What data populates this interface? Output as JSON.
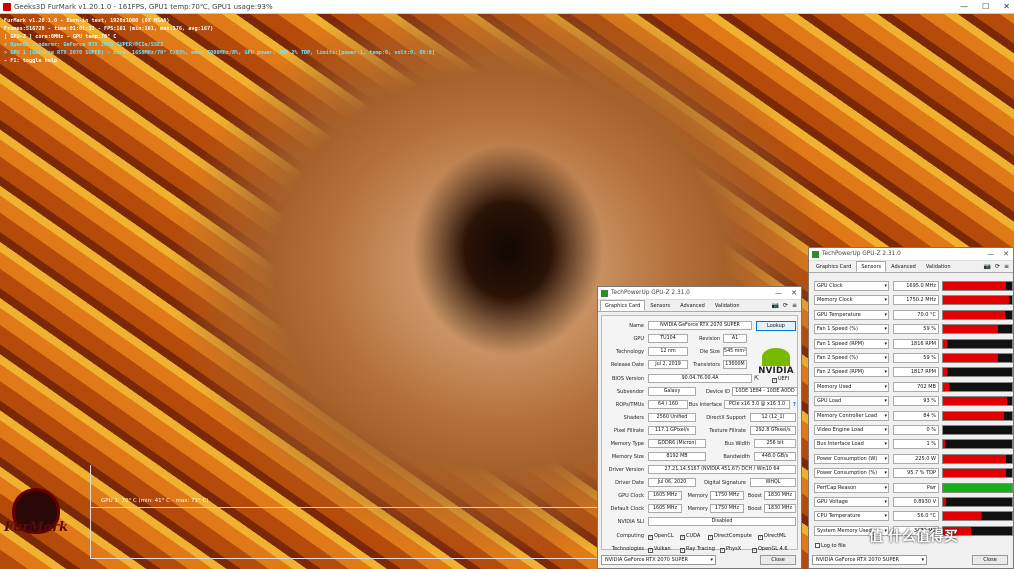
{
  "furmark": {
    "window_title": "Geeks3D FurMark v1.20.1.0 - 161FPS, GPU1 temp:70℃, GPU1 usage:93%",
    "hud": [
      {
        "t": "FurMark v1.20.1.0 - Burn-in test, 1920x1080 (8X MSAA)",
        "c": "w"
      },
      {
        "t": "Frames:516720 - time:01:01:32 - FPS:161 (min:161, max:176, avg:167)",
        "c": "w"
      },
      {
        "t": "[ GPU-Z ] core:0MHz - GPU temp:70° C",
        "c": "w"
      },
      {
        "t": "> OpenGL renderer: GeForce RTX 2070 SUPER/PCIe/SSE2",
        "c": "c"
      },
      {
        "t": "> GPU 1 (GeForce RTX 2070 SUPER) - core: 1650MHz/70° C/93%, mem: 7000MHz/8%, GPU power: 100.2% TDP, limits:[power:1, temp:0, volt:0, OV:0]",
        "c": "c"
      },
      {
        "t": "- F1: toggle help",
        "c": "w"
      }
    ],
    "graph_label": "GPU 1: 70° C (min: 41° C - max: 71° C)",
    "logo": "FurMark"
  },
  "gpuz_card": {
    "title": "TechPowerUp GPU-Z 2.31.0",
    "tabs": [
      "Graphics Card",
      "Sensors",
      "Advanced",
      "Validation"
    ],
    "labels": {
      "name": "Name",
      "gpu": "GPU",
      "revision": "Revision",
      "technology": "Technology",
      "die_size": "Die Size",
      "release_date": "Release Date",
      "transistors": "Transistors",
      "bios": "BIOS Version",
      "subvendor": "Subvendor",
      "device_id": "Device ID",
      "rops": "ROPs/TMUs",
      "bus": "Bus Interface",
      "shaders": "Shaders",
      "directx": "DirectX Support",
      "pixel": "Pixel Fillrate",
      "texture": "Texture Fillrate",
      "mem_type": "Memory Type",
      "bus_width": "Bus Width",
      "mem_size": "Memory Size",
      "bandwidth": "Bandwidth",
      "driver": "Driver Version",
      "driver_date": "Driver Date",
      "digsig": "Digital Signature",
      "gpu_clock": "GPU Clock",
      "memory": "Memory",
      "boost": "Boost",
      "default_clock": "Default Clock",
      "sli": "NVIDIA SLI",
      "computing": "Computing",
      "technologies": "Technologies"
    },
    "values": {
      "name": "NVIDIA GeForce RTX 2070 SUPER",
      "gpu": "TU104",
      "revision": "A1",
      "technology": "12 nm",
      "die_size": "545 mm²",
      "release_date": "Jul 2, 2019",
      "transistors": "13600M",
      "bios": "90.04.76.00.4A",
      "subvendor": "Galaxy",
      "device_id": "10DE 1E84 - 10DE A0DD",
      "rops": "64 / 160",
      "bus": "PCIe x16 3.0 @ x16 3.0",
      "shaders": "2560 Unified",
      "directx": "12 (12_1)",
      "pixel": "117.1 GPixel/s",
      "texture": "292.8 GTexel/s",
      "mem_type": "GDDR6 (Micron)",
      "bus_width": "256 bit",
      "mem_size": "8192 MB",
      "bandwidth": "448.0 GB/s",
      "driver": "27.21.14.5167 (NVIDIA 451.67) DCH / Win10 64",
      "driver_date": "Jul 06, 2020",
      "digsig": "WHQL",
      "gpu_clock": "1605 MHz",
      "gpu_mem": "1750 MHz",
      "gpu_boost": "1830 MHz",
      "def_clock": "1605 MHz",
      "def_mem": "1750 MHz",
      "def_boost": "1830 MHz",
      "sli": "Disabled"
    },
    "lookup": "Lookup",
    "uefi": "UEFI",
    "question": "?",
    "brand": "NVIDIA",
    "computing": [
      "OpenCL",
      "CUDA",
      "DirectCompute",
      "DirectML"
    ],
    "technologies": [
      "Vulkan",
      "Ray Tracing",
      "PhysX",
      "OpenGL 4.6"
    ],
    "footer_select": "NVIDIA GeForce RTX 2070 SUPER",
    "close": "Close"
  },
  "gpuz_sensors": {
    "title": "TechPowerUp GPU-Z 2.31.0",
    "tabs": [
      "Graphics Card",
      "Sensors",
      "Advanced",
      "Validation"
    ],
    "rows": [
      {
        "name": "GPU Clock",
        "value": "1695.0 MHz",
        "fill": 0.92,
        "color": "#e00000"
      },
      {
        "name": "Memory Clock",
        "value": "1750.2 MHz",
        "fill": 0.95,
        "color": "#e00000"
      },
      {
        "name": "GPU Temperature",
        "value": "70.0 °C",
        "fill": 0.9,
        "color": "#e00000"
      },
      {
        "name": "Fan 1 Speed (%)",
        "value": "59 %",
        "fill": 0.8,
        "color": "#e00000"
      },
      {
        "name": "Fan 1 Speed (RPM)",
        "value": "1816 RPM",
        "fill": 0.06,
        "color": "#e00000"
      },
      {
        "name": "Fan 2 Speed (%)",
        "value": "59 %",
        "fill": 0.8,
        "color": "#e00000"
      },
      {
        "name": "Fan 2 Speed (RPM)",
        "value": "1817 RPM",
        "fill": 0.06,
        "color": "#e00000"
      },
      {
        "name": "Memory Used",
        "value": "702 MB",
        "fill": 0.08,
        "color": "#e00000"
      },
      {
        "name": "GPU Load",
        "value": "93 %",
        "fill": 0.93,
        "color": "#e00000"
      },
      {
        "name": "Memory Controller Load",
        "value": "84 %",
        "fill": 0.88,
        "color": "#e00000"
      },
      {
        "name": "Video Engine Load",
        "value": "0 %",
        "fill": 0,
        "color": "#e00000"
      },
      {
        "name": "Bus Interface Load",
        "value": "1 %",
        "fill": 0.03,
        "color": "#e00000"
      },
      {
        "name": "Power Consumption (W)",
        "value": "225.0 W",
        "fill": 0.92,
        "color": "#e00000"
      },
      {
        "name": "Power Consumption (%)",
        "value": "95.7 % TDP",
        "fill": 0.92,
        "color": "#e00000"
      },
      {
        "name": "PerfCap Reason",
        "value": "Pwr",
        "fill": 1.0,
        "color": "#18b018"
      },
      {
        "name": "GPU Voltage",
        "value": "0.8930 V",
        "fill": 0.05,
        "color": "#e00000"
      },
      {
        "name": "CPU Temperature",
        "value": "56.0 °C",
        "fill": 0.55,
        "color": "#e00000"
      },
      {
        "name": "System Memory Used",
        "value": "3479 MB",
        "fill": 0.4,
        "color": "#e00000"
      }
    ],
    "log_label": "Log to file",
    "footer_select": "NVIDIA GeForce RTX 2070 SUPER",
    "close": "Close"
  },
  "watermark": "值 什么值得买"
}
